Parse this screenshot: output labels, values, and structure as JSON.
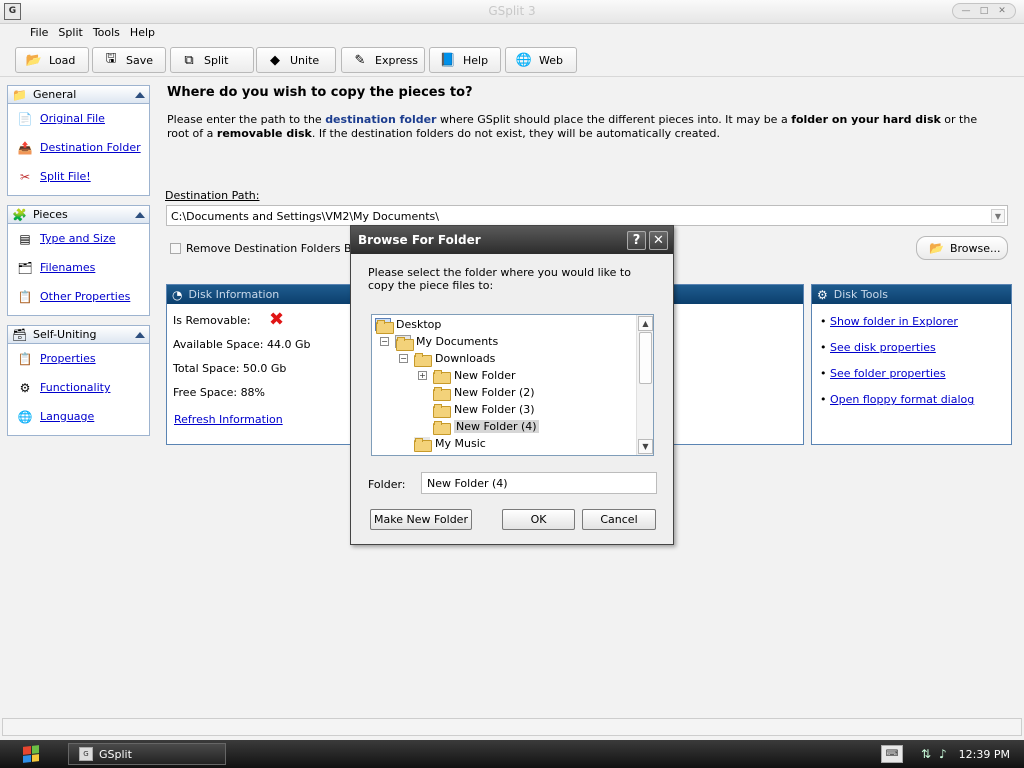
{
  "window": {
    "title": "GSplit 3"
  },
  "menu": [
    "File",
    "Split",
    "Tools",
    "Help"
  ],
  "toolbar": [
    {
      "label": "Load",
      "icon": "load-icon"
    },
    {
      "label": "Save",
      "icon": "save-icon"
    },
    {
      "label": "Split",
      "icon": "split-icon"
    },
    {
      "label": "Unite",
      "icon": "unite-icon"
    },
    {
      "label": "Express",
      "icon": "express-icon"
    },
    {
      "label": "Help",
      "icon": "help-book-icon"
    },
    {
      "label": "Web",
      "icon": "globe-icon"
    }
  ],
  "sidebar": {
    "general": {
      "title": "General",
      "items": [
        "Original File",
        "Destination Folder",
        "Split File!"
      ]
    },
    "pieces": {
      "title": "Pieces",
      "items": [
        "Type and Size",
        "Filenames",
        "Other Properties"
      ]
    },
    "self_uniting": {
      "title": "Self-Uniting",
      "items": [
        "Properties",
        "Functionality",
        "Language"
      ]
    }
  },
  "main": {
    "heading": "Where do you wish to copy the pieces to?",
    "desc_1": "Please enter the path to the ",
    "desc_b1": "destination folder",
    "desc_2": " where GSplit should place the different pieces into. It may be a ",
    "desc_b2": "folder on your hard disk",
    "desc_3": " or the root of a ",
    "desc_b3": "removable disk",
    "desc_4": ". If the destination folders do not exist, they will be automatically created.",
    "dest_label": "Destination Path:",
    "dest_value": "C:\\Documents and Settings\\VM2\\My Documents\\",
    "remove_checkbox": "Remove Destination Folders Befor",
    "browse": "Browse..."
  },
  "disk_info": {
    "title": "Disk Information",
    "is_removable": "Is Removable:",
    "available": "Available Space: 44.0 Gb",
    "total": "Total Space: 50.0 Gb",
    "free": "Free Space: 88%",
    "refresh": "Refresh Information"
  },
  "disk_tools": {
    "title": "Disk Tools",
    "links": [
      "Show folder in Explorer",
      "See disk properties",
      "See folder properties",
      "Open floppy format dialog"
    ]
  },
  "dialog": {
    "title": "Browse For Folder",
    "help_btn": "?",
    "close_btn": "✕",
    "text": "Please select the folder where you would like to copy the piece files to:",
    "tree": [
      {
        "label": "Desktop",
        "level": 0,
        "expander": ""
      },
      {
        "label": "My Documents",
        "level": 1,
        "expander": "−"
      },
      {
        "label": "Downloads",
        "level": 2,
        "expander": "−"
      },
      {
        "label": "New Folder",
        "level": 3,
        "expander": "+"
      },
      {
        "label": "New Folder (2)",
        "level": 3,
        "expander": ""
      },
      {
        "label": "New Folder (3)",
        "level": 3,
        "expander": ""
      },
      {
        "label": "New Folder (4)",
        "level": 3,
        "expander": "",
        "selected": true
      },
      {
        "label": "My Music",
        "level": 2,
        "expander": ""
      }
    ],
    "folder_label": "Folder:",
    "folder_value": "New Folder (4)",
    "make_new": "Make New Folder",
    "ok": "OK",
    "cancel": "Cancel"
  },
  "taskbar": {
    "app": "GSplit",
    "clock": "12:39 PM"
  }
}
